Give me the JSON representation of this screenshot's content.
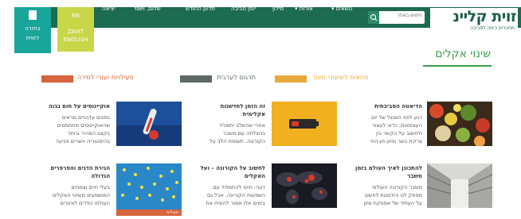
{
  "site": {
    "logo_text": "זוית",
    "logo_text2": "קליינ",
    "logo_sub": "מחברים כיתה לסביבה",
    "accent_green": "#1d6b50",
    "title_green": "#3b9f4a"
  },
  "nav": {
    "items": [
      "נושאים",
      "אורות",
      "מילון",
      "יומן סביבה",
      "מדען החודש"
    ],
    "dropdown_marker": "▾",
    "search_placeholder": "חיפוש באתר",
    "user_greeting": "שלום, Yael",
    "logout": "יציאה"
  },
  "back_box": {
    "label1": "בחזרה",
    "label2": "לזווית"
  },
  "en_box": {
    "label1": "EN",
    "label2": "ZAVIT",
    "label3": "ENGLISH"
  },
  "page": {
    "title": "שינוי אקלים"
  },
  "filters": [
    {
      "label": "מתאים לשיעורי חינוך",
      "color": "#e8a93a",
      "label_color": "#e8a93a"
    },
    {
      "label": "תרגום לערבית",
      "color": "#5f6a66",
      "label_color": "#5f6a66"
    },
    {
      "label": "פעילויות ועזרי למידה",
      "color": "#d6643c",
      "label_color": "#d6643c"
    }
  ],
  "cards": [
    {
      "title": "הדיאטה הסביבתית",
      "lines": [
        "רגע לפני המנגל של יום",
        "העצמאות, כדאי לעצור",
        "ולחשוב על הקשר בין",
        "צריכת בשר ומזון מן-החי"
      ]
    },
    {
      "title": "זה הזמן לחדשנות",
      "title2": "אקלימית",
      "lines": [
        "אחרי שהשלב יתמודד",
        "בהצלחה עם משבר",
        "הקורונה, תשומת הלב על"
      ]
    },
    {
      "title": "אוקיינוסים על חום גבוה",
      "lines": [
        "נתונים עדכניים מראים",
        "שהאוקיינוסים מתחממים",
        "בקצב המהיר ביותר",
        "בהיסטוריה ויוצרים פגיעה"
      ]
    },
    {
      "title": "להתכונן לאיך העולם בזמן",
      "title2": "משבר",
      "lines": [
        "משבר הקורונה העולמי",
        "מספק לנו הזדמנות לחשוב",
        "על העתיד של אספקת מזון"
      ]
    },
    {
      "title": "לחשוב על הקורונה – ועל",
      "title2": "האקלים",
      "lines": [
        "דעה: חיינו להתמודד עם",
        "השפעות הקורונה, אבל גם",
        "בימים אלו אסור להזניח את"
      ]
    },
    {
      "title": "הגירת הדגים והפרפרים",
      "title2": "הגדולה",
      "lines": [
        "בעלי חיים וצמחים",
        "המושפעים משינוי האקלים",
        "העולמי נודדים לאזורים"
      ],
      "badge": "פעילות"
    }
  ]
}
